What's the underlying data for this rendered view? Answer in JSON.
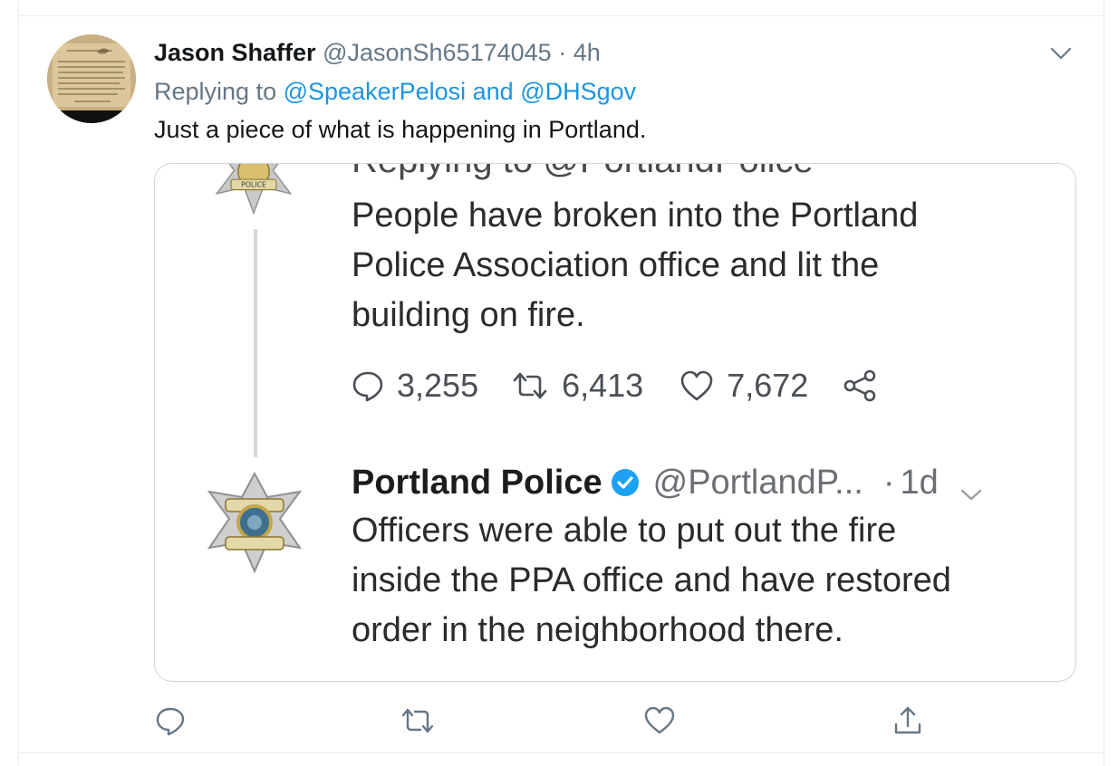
{
  "tweet": {
    "author_name": "Jason Shaffer",
    "author_handle": "@JasonSh65174045",
    "separator": "·",
    "time": "4h",
    "replying_to_prefix": "Replying to",
    "mention_1": "@SpeakerPelosi",
    "conjunction": "and",
    "mention_2": "@DHSgov",
    "text": "Just a piece of what is happening in Portland.",
    "avatar_icon": "document-avatar-icon",
    "caret_icon": "chevron-down-icon"
  },
  "media": {
    "cut_text": "Replying to @PortlandPolice",
    "quoted_lines": [
      "People have broken into the Portland",
      "Police Association office and lit the",
      "building on fire."
    ],
    "stats": {
      "replies": "3,255",
      "retweets": "6,413",
      "likes": "7,672"
    },
    "second": {
      "name": "Portland Police",
      "handle": "@PortlandP...",
      "separator": "·",
      "time": "1d",
      "lines": [
        "Officers were able to put out the fire",
        "inside the PPA office and have restored",
        "order in the neighborhood there."
      ]
    },
    "badge_icon": "police-badge-icon"
  },
  "actions": {
    "reply_icon": "reply-icon",
    "retweet_icon": "retweet-icon",
    "like_icon": "heart-icon",
    "share_icon": "share-icon"
  },
  "colors": {
    "link": "#1b95e0",
    "muted": "#657786",
    "border": "#ccd6dd",
    "verified": "#1da1f2"
  }
}
